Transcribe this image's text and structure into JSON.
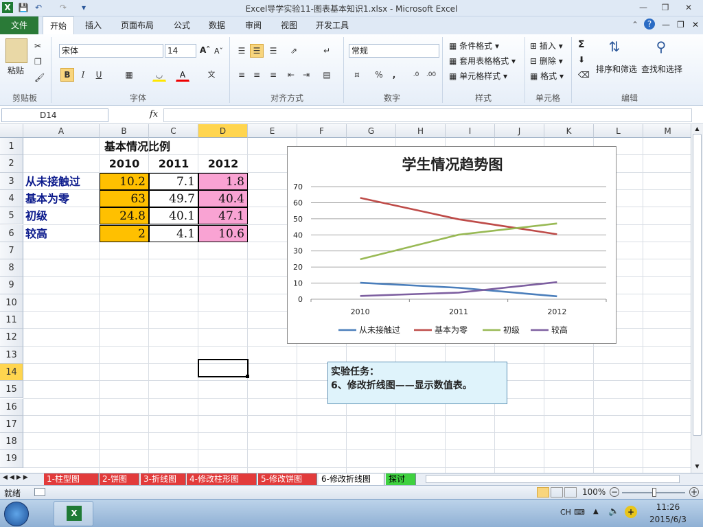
{
  "window": {
    "title": "Excel导学实验11-图表基本知识1.xlsx - Microsoft Excel"
  },
  "tabs": [
    "文件",
    "开始",
    "插入",
    "页面布局",
    "公式",
    "数据",
    "审阅",
    "视图",
    "开发工具"
  ],
  "ribbon": {
    "clipboard": {
      "paste": "粘贴",
      "label": "剪贴板"
    },
    "font": {
      "name": "宋体",
      "size": "14",
      "bold": "B",
      "italic": "I",
      "underline": "U",
      "label": "字体"
    },
    "align": {
      "label": "对齐方式"
    },
    "number": {
      "format": "常规",
      "percent": "%",
      "comma": ",",
      "label": "数字"
    },
    "styles": {
      "cond": "条件格式",
      "table": "套用表格格式",
      "cell": "单元格样式",
      "label": "样式"
    },
    "cells": {
      "insert": "插入",
      "delete": "删除",
      "format": "格式",
      "label": "单元格"
    },
    "edit": {
      "sort": "排序和筛选",
      "find": "查找和选择",
      "label": "编辑",
      "sigma": "Σ"
    }
  },
  "formula": {
    "namebox": "D14",
    "fx": "fx",
    "value": ""
  },
  "columns": [
    "A",
    "B",
    "C",
    "D",
    "E",
    "F",
    "G",
    "H",
    "I",
    "J",
    "K",
    "L",
    "M"
  ],
  "rows": [
    "1",
    "2",
    "3",
    "4",
    "5",
    "6",
    "7",
    "8",
    "9",
    "10",
    "11",
    "12",
    "13",
    "14",
    "15",
    "16",
    "17",
    "18",
    "19"
  ],
  "table": {
    "title": "基本情况比例",
    "years": [
      "2010",
      "2011",
      "2012"
    ],
    "rows": [
      {
        "label": "从未接触过",
        "values": [
          "10.2",
          "7.1",
          "1.8"
        ]
      },
      {
        "label": "基本为零",
        "values": [
          "63",
          "49.7",
          "40.4"
        ]
      },
      {
        "label": "初级",
        "values": [
          "24.8",
          "40.1",
          "47.1"
        ]
      },
      {
        "label": "较高",
        "values": [
          "2",
          "4.1",
          "10.6"
        ]
      }
    ]
  },
  "chart_data": {
    "type": "line",
    "title": "学生情况趋势图",
    "categories": [
      "2010",
      "2011",
      "2012"
    ],
    "ylim": [
      0,
      70
    ],
    "yticks": [
      "0",
      "10",
      "20",
      "30",
      "40",
      "50",
      "60",
      "70"
    ],
    "grid": true,
    "legend": "bottom",
    "series": [
      {
        "name": "从未接触过",
        "values": [
          10.2,
          7.1,
          1.8
        ],
        "color": "#4a7ebb"
      },
      {
        "name": "基本为零",
        "values": [
          63,
          49.7,
          40.4
        ],
        "color": "#be4b48"
      },
      {
        "name": "初级",
        "values": [
          24.8,
          40.1,
          47.1
        ],
        "color": "#98b954"
      },
      {
        "name": "较高",
        "values": [
          2,
          4.1,
          10.6
        ],
        "color": "#7d5fa0"
      }
    ]
  },
  "note": {
    "line1": "实验任务：",
    "line2": "6、修改折线图——显示数值表。"
  },
  "sheets": [
    {
      "name": "1-柱型图",
      "color": "#e23b3b",
      "active": false
    },
    {
      "name": "2-饼图",
      "color": "#e23b3b",
      "active": false
    },
    {
      "name": "3-折线图",
      "color": "#e23b3b",
      "active": false
    },
    {
      "name": "4-修改柱形图",
      "color": "#e23b3b",
      "active": false
    },
    {
      "name": "5-修改饼图",
      "color": "#e23b3b",
      "active": false
    },
    {
      "name": "6-修改折线图",
      "color": "#ffffff",
      "active": true
    },
    {
      "name": "探讨",
      "color": "#3fd13f",
      "active": false
    }
  ],
  "status": {
    "ready": "就绪",
    "zoom": "100%"
  },
  "taskbar": {
    "lang": "CH",
    "time": "11:26",
    "date": "2015/6/3"
  },
  "colors": {
    "orange": "#ffc000",
    "pink": "#f9a3d3",
    "accent": "#2a7a37"
  }
}
